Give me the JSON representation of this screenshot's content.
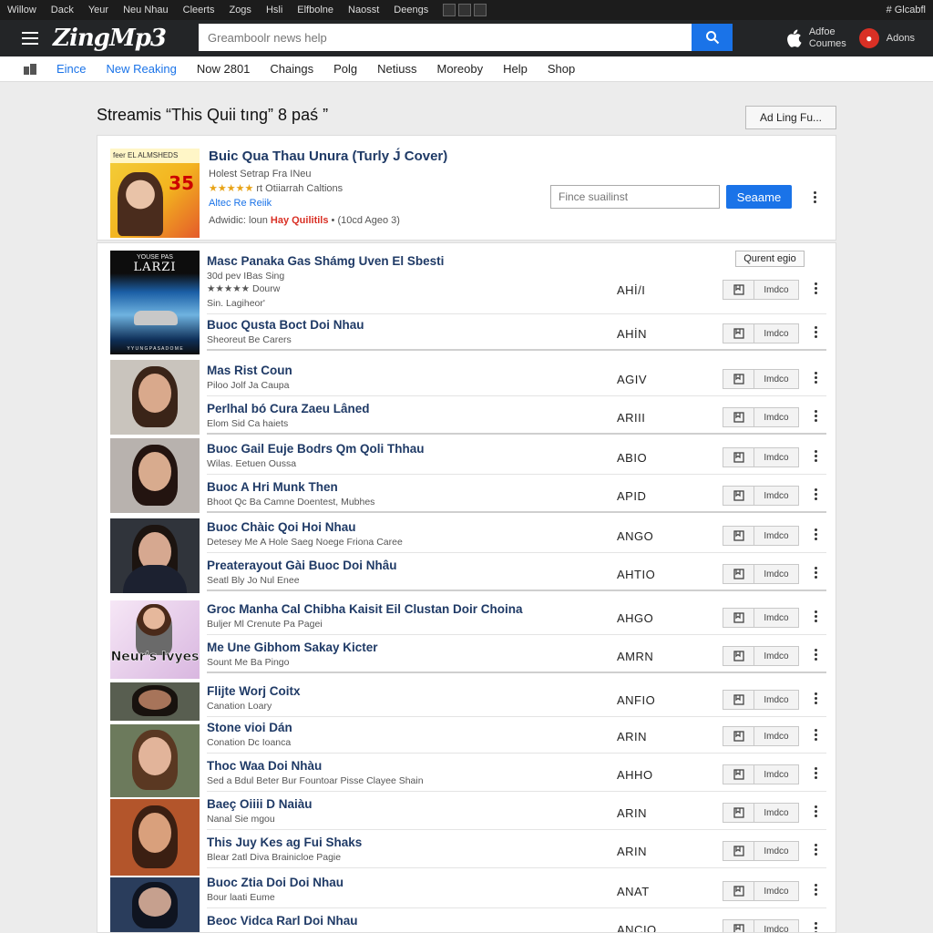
{
  "sysbar": {
    "menu": [
      "Willow",
      "Dack",
      "Yeur",
      "Neu Nhau",
      "Cleerts",
      "Zogs",
      "Hsli",
      "Elfbolne",
      "Naosst",
      "Deengs"
    ],
    "right": "# Glcabfl"
  },
  "header": {
    "logo": "ZingMp3",
    "search_placeholder": "Greamboolr news help",
    "right_items": [
      {
        "line1": "Adfoe",
        "line2": "Coumes"
      },
      {
        "label": "Adons"
      }
    ]
  },
  "nav": {
    "items": [
      {
        "label": "Eince",
        "active": true
      },
      {
        "label": "New Reaking",
        "active": true
      },
      {
        "label": "Now 2801",
        "active": false
      },
      {
        "label": "Chaings",
        "active": false
      },
      {
        "label": "Polg",
        "active": false
      },
      {
        "label": "Netiuss",
        "active": false
      },
      {
        "label": "Moreoby",
        "active": false
      },
      {
        "label": "Help",
        "active": false
      },
      {
        "label": "Shop",
        "active": false
      }
    ]
  },
  "page": {
    "title": "Streamis “This Quii tıng” 8 paś ”",
    "add_button": "Ad Ling Fu..."
  },
  "featured": {
    "title": "Buic Qua Thau Unura (Turly J́ Cover)",
    "subtitle": "Holest Setrap Fra INeu",
    "stars": "★★★★★",
    "rating_text": "rt Otiiarrah Caltions",
    "link": "Altec Re Reiik",
    "meta_prefix": "Adwidic: loun",
    "meta_highlight": "Hay Quilitils",
    "meta_suffix": "• (10cd Ageo 3)",
    "input_placeholder": "Fince suailinst",
    "button": "Seaame",
    "thumb_num": "35",
    "thumb_banner": "feer EL ALMSHEDS"
  },
  "list": {
    "sort_label": "Qurent egio",
    "control_label": "Imdco",
    "tracks": [
      {
        "title": "Masc Panaka Gas Shámg Uven El Sbesti",
        "sub": "30d pev IBas Sing",
        "rating": "★★★★★ Dourw",
        "extra": "Sin. Lagiheor'",
        "code": "AHİ/I"
      },
      {
        "title": "Buoc Qusta Boct Doi Nhau",
        "sub": "Sheoreut Be Carers",
        "code": "AHİN"
      },
      {
        "title": "Mas Rist Coun",
        "sub": "Piloo Jolf Ja Caupa",
        "code": "AGIV"
      },
      {
        "title": "Perlhal bó Cura Zaeu Lâned",
        "sub": "Elom Sid Ca haiets",
        "code": "ARIII"
      },
      {
        "title": "Buoc Gail Euje Bodrs Qm Qoli Thhau",
        "sub": "Wilas. Eetuen Oussa",
        "code": "ABIO"
      },
      {
        "title": "Buoc A Hri Munk Then",
        "sub": "Bhoot Qc Ba Camne Doentest, Mubhes",
        "code": "APID"
      },
      {
        "title": "Buoc Chàic Qoi Hoi Nhau",
        "sub": "Detesey Me A Hole Saeg Noege Friona Caree",
        "code": "ANGO"
      },
      {
        "title": "Preaterayout Gài Buoc Doi Nhâu",
        "sub": "Seatl Bly Jo Nul Enee",
        "code": "AHTIO"
      },
      {
        "title": "Groc Manha Cal Chibha Kaisit Eil Clustan Doir Choina",
        "sub": "Buljer Ml Crenute Pa Pagei",
        "code": "AHGO"
      },
      {
        "title": "Me Une Gibhom Sakay Kicter",
        "sub": "Sount Me Ba Pingo",
        "code": "AMRN"
      },
      {
        "title": "Flijte Worj Coitx",
        "sub": "Canation Loary",
        "code": "ANFIO"
      },
      {
        "title": "Stone vioi Dán",
        "sub": "Conation Dc Ioanca",
        "code": "ARIN"
      },
      {
        "title": "Thoc Waa Doi Nhàu",
        "sub": "Sed a Bdul Beter Bur Fountoar Pisse Clayee Shain",
        "code": "AHHO"
      },
      {
        "title": "Baeç Oiiii D Naiàu",
        "sub": "Nanal Sie mgou",
        "code": "ARIN"
      },
      {
        "title": "This Juy Kes ag Fui Shaks",
        "sub": "Blear 2atl Diva Brainicloe Pagie",
        "code": "ARIN"
      },
      {
        "title": "Buoc Ztia Doi Doi Nhau",
        "sub": "Bour laati Eume",
        "code": "ANAT"
      },
      {
        "title": "Beoc Vidca Rarl Doi Nhau",
        "sub": "",
        "code": "ANCIO"
      }
    ],
    "thumb_texts": {
      "first_top": "YOUSE PAS",
      "first_big": "LARZI",
      "first_bottom": "Y Y U N G P A S A D O M E",
      "overlay": "Neur's Ivyes"
    }
  }
}
